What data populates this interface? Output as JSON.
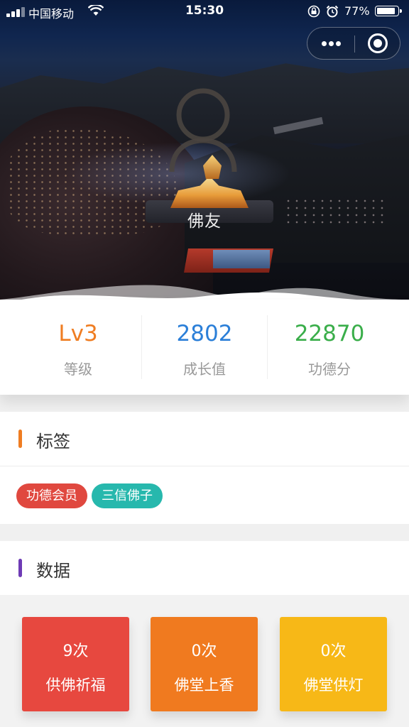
{
  "status_bar": {
    "carrier": "中国移动",
    "time": "15:30",
    "battery_percent": "77%",
    "battery_level": 0.77
  },
  "profile": {
    "nickname": "佛友"
  },
  "stats": [
    {
      "value": "Lv3",
      "label": "等级",
      "color": "#ef7d22"
    },
    {
      "value": "2802",
      "label": "成长值",
      "color": "#2b7fd8"
    },
    {
      "value": "22870",
      "label": "功德分",
      "color": "#3aae4a"
    }
  ],
  "tags_section": {
    "title": "标签",
    "accent": "#ef7d22",
    "tags": [
      {
        "label": "功德会员",
        "color": "#e0483f"
      },
      {
        "label": "三信佛子",
        "color": "#27b8ad"
      }
    ]
  },
  "data_section": {
    "title": "数据",
    "accent": "#6e3bb5",
    "tiles": [
      {
        "count": "9次",
        "name": "供佛祈福",
        "color": "#e7483f"
      },
      {
        "count": "0次",
        "name": "佛堂上香",
        "color": "#f07a1f"
      },
      {
        "count": "0次",
        "name": "佛堂供灯",
        "color": "#f7b817"
      }
    ]
  },
  "icons": {
    "signal": "signal-icon",
    "wifi": "wifi-icon",
    "lock": "orientation-lock-icon",
    "alarm": "alarm-icon",
    "battery": "battery-icon",
    "more": "more-dots-icon",
    "close": "close-miniprogram-icon",
    "avatar": "user-avatar-icon"
  }
}
